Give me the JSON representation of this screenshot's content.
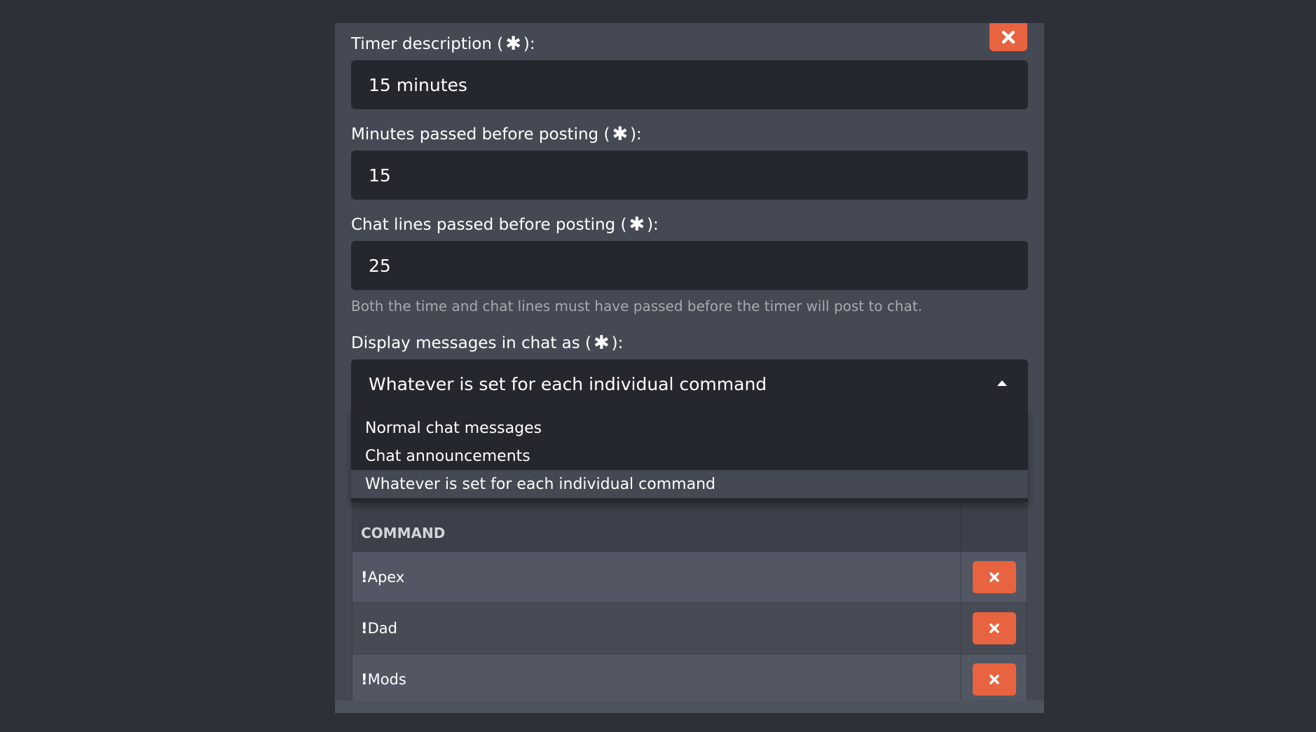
{
  "form": {
    "description_label": "Timer description (",
    "description_label_end": "):",
    "description_value": "15 minutes",
    "minutes_label": "Minutes passed before posting (",
    "minutes_label_end": "):",
    "minutes_value": "15",
    "lines_label": "Chat lines passed before posting (",
    "lines_label_end": "):",
    "lines_value": "25",
    "help_text": "Both the time and chat lines must have passed before the timer will post to chat.",
    "display_label": "Display messages in chat as (",
    "display_label_end": "):",
    "display_value": "Whatever is set for each individual command",
    "required_marker": "✱"
  },
  "dropdown": {
    "options": [
      "Normal chat messages",
      "Chat announcements",
      "Whatever is set for each individual command"
    ],
    "selected_index": 2
  },
  "table": {
    "header": "COMMAND",
    "rows": [
      {
        "prefix": "!",
        "name": "Apex"
      },
      {
        "prefix": "!",
        "name": "Dad"
      },
      {
        "prefix": "!",
        "name": "Mods"
      }
    ]
  },
  "colors": {
    "background": "#2d3039",
    "panel": "#454953",
    "input": "#25272e",
    "danger": "#e8633f"
  },
  "icons": {
    "close": "close-icon",
    "delete": "times-icon",
    "caret": "caret-up-icon",
    "required": "asterisk-icon"
  }
}
